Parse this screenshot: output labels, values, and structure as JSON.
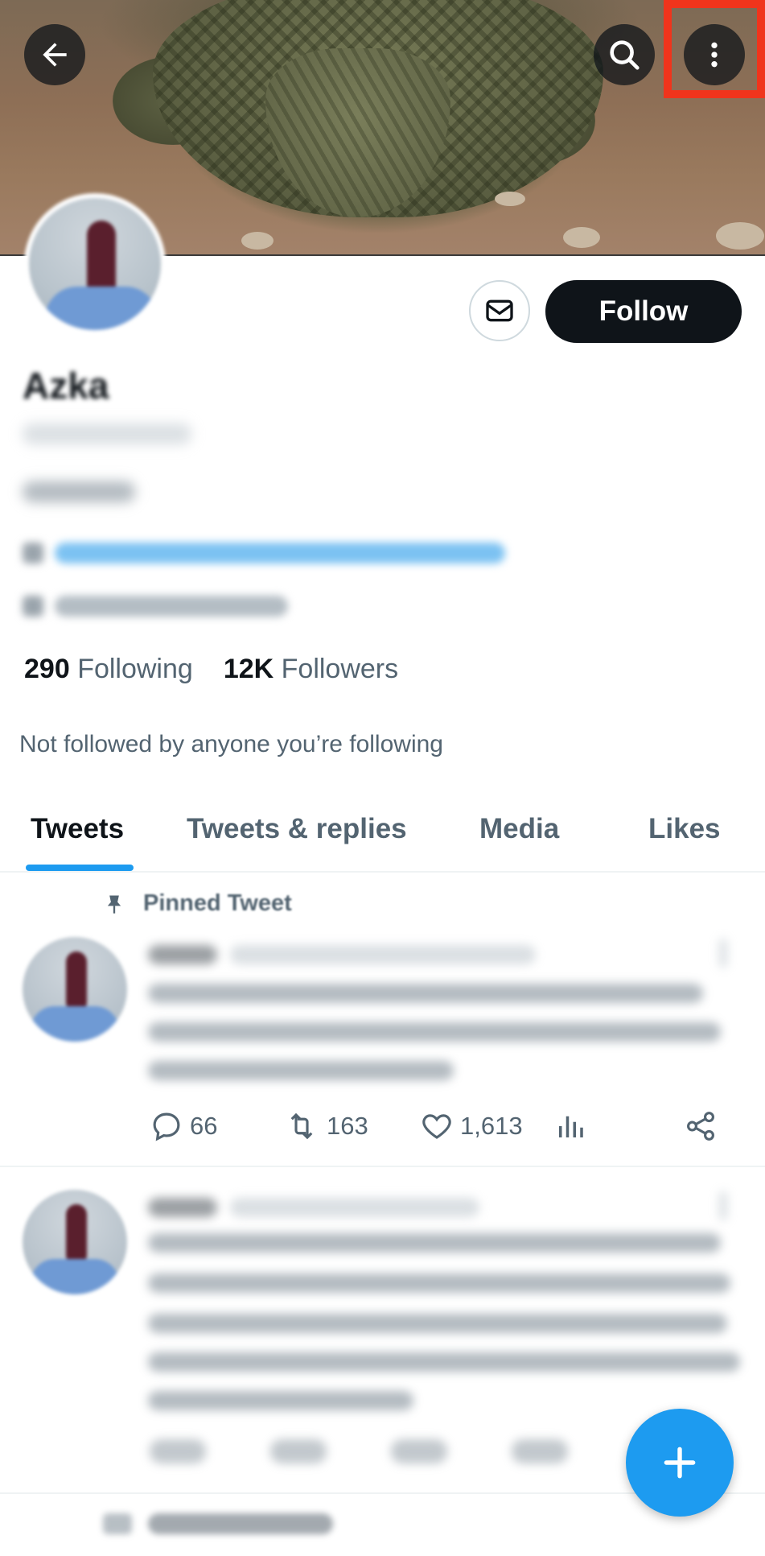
{
  "header": {
    "back_icon": "arrow-left-icon",
    "search_icon": "search-icon",
    "more_icon": "more-vertical-icon",
    "highlight_color": "#f0341c"
  },
  "profile": {
    "name": "Azka",
    "follow_label": "Follow",
    "message_icon": "mail-icon",
    "following_count": "290",
    "following_label": "Following",
    "followers_count": "12K",
    "followers_label": "Followers",
    "not_followed_text": "Not followed by anyone you’re following"
  },
  "tabs": [
    {
      "label": "Tweets",
      "active": true
    },
    {
      "label": "Tweets & replies",
      "active": false
    },
    {
      "label": "Media",
      "active": false
    },
    {
      "label": "Likes",
      "active": false
    }
  ],
  "tweets": [
    {
      "pinned_label": "Pinned Tweet",
      "replies": "66",
      "retweets": "163",
      "likes": "1,613"
    }
  ],
  "colors": {
    "accent": "#1d9bf0",
    "text_primary": "#0f1419",
    "text_secondary": "#536471"
  }
}
